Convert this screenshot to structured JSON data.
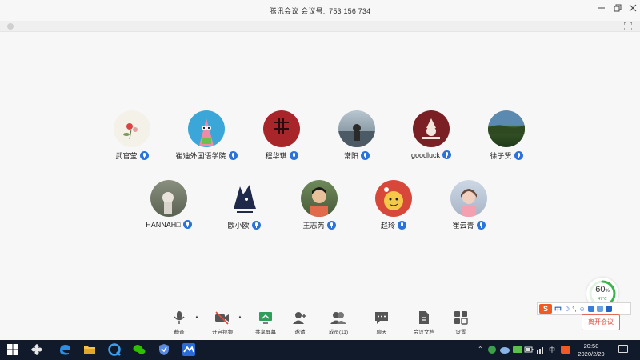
{
  "window": {
    "app_name": "腾讯会议",
    "meeting_label": "会议号:",
    "meeting_id": "753 156 734"
  },
  "participants_row1": [
    {
      "name": "武官莹",
      "icon": "mic-icon"
    },
    {
      "name": "崔迪外国语学院",
      "icon": "mic-icon"
    },
    {
      "name": "程华琪",
      "icon": "mic-icon"
    },
    {
      "name": "常阳",
      "icon": "mic-icon"
    },
    {
      "name": "goodluck",
      "icon": "mic-icon"
    },
    {
      "name": "徐子贤",
      "icon": "mic-icon"
    }
  ],
  "participants_row2": [
    {
      "name": "HANNAH□",
      "icon": "mic-icon"
    },
    {
      "name": "欧小欧",
      "icon": "mic-icon"
    },
    {
      "name": "王志芮",
      "icon": "mic-icon"
    },
    {
      "name": "赵玲",
      "icon": "mic-icon"
    },
    {
      "name": "崔云青",
      "icon": "mic-icon"
    }
  ],
  "toolbar": {
    "mute": "静音",
    "video": "开启视频",
    "share": "共享屏幕",
    "invite": "邀请",
    "members": "成员(11)",
    "chat": "聊天",
    "docs": "会议文档",
    "settings": "设置",
    "leave": "离开会议"
  },
  "perf_widget": {
    "percent": "60",
    "percent_unit": "%",
    "temp": "47℃",
    "ring_fraction": 0.6
  },
  "ime": {
    "logo": "S",
    "lang": "中"
  },
  "taskbar": {
    "ime_indicator": "中",
    "time": "20:50",
    "date": "2020/2/29"
  },
  "colors": {
    "accent_blue": "#2a73d9",
    "leave_red": "#e04a3a",
    "taskbar": "#101a2a"
  }
}
